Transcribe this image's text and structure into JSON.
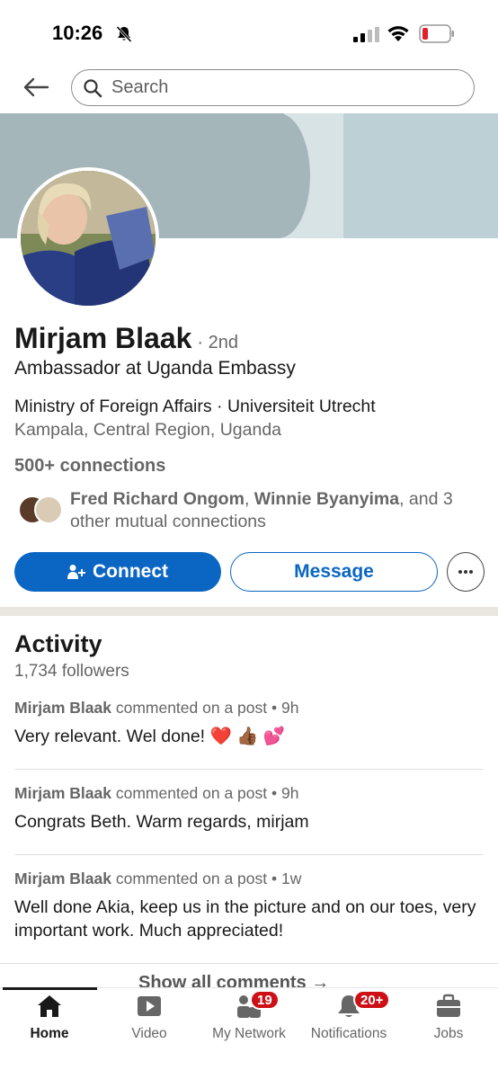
{
  "status_bar": {
    "time": "10:26"
  },
  "header": {
    "search_placeholder": "Search"
  },
  "profile": {
    "name": "Mirjam Blaak",
    "degree": "· 2nd",
    "headline": "Ambassador at Uganda Embassy",
    "orgs": "Ministry of Foreign Affairs · Universiteit Utrecht",
    "location": "Kampala, Central Region, Uganda",
    "connections": "500+ connections",
    "mutual": {
      "name1": "Fred Richard Ongom",
      "sep": ", ",
      "name2": "Winnie Byanyima",
      "rest": ", and 3 other mutual connections"
    },
    "connect_label": "Connect",
    "message_label": "Message"
  },
  "activity": {
    "title": "Activity",
    "followers": "1,734 followers",
    "items": [
      {
        "author": "Mirjam Blaak",
        "action": " commented on a post • 9h",
        "text": "Very relevant. Wel done! ❤️ 👍🏾 💕"
      },
      {
        "author": "Mirjam Blaak",
        "action": " commented on a post • 9h",
        "text": "Congrats Beth. Warm regards, mirjam"
      },
      {
        "author": "Mirjam Blaak",
        "action": " commented on a post • 1w",
        "text": "Well done Akia, keep us in the picture and on our toes, very important work. Much appreciated!"
      }
    ],
    "show_all": "Show all comments →"
  },
  "tabbar": {
    "tabs": [
      {
        "label": "Home"
      },
      {
        "label": "Video"
      },
      {
        "label": "My Network",
        "badge": "19"
      },
      {
        "label": "Notifications",
        "badge": "20+"
      },
      {
        "label": "Jobs"
      }
    ]
  },
  "colors": {
    "brand_blue": "#0a66c2",
    "badge_red": "#cc1016"
  }
}
